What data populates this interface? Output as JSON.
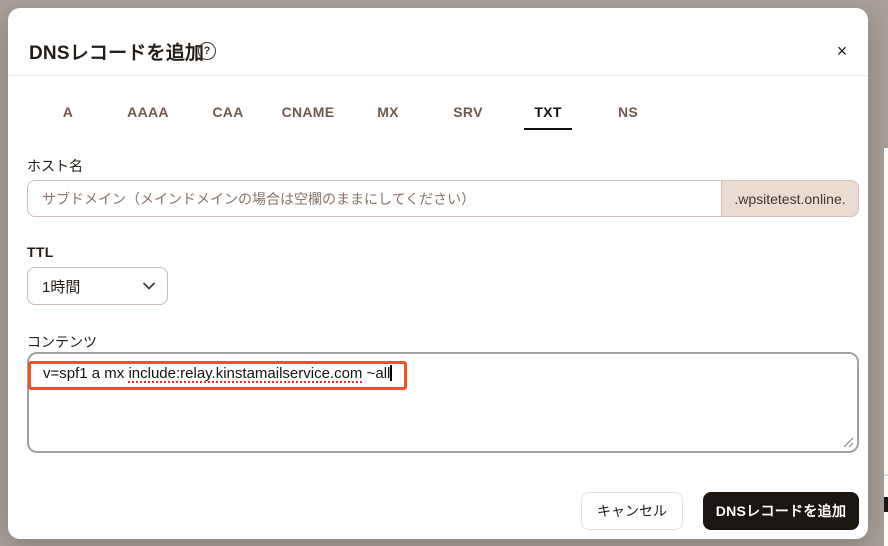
{
  "modal": {
    "title": "DNSレコードを追加",
    "help_symbol": "?",
    "close_symbol": "×"
  },
  "tabs": [
    {
      "label": "A"
    },
    {
      "label": "AAAA"
    },
    {
      "label": "CAA"
    },
    {
      "label": "CNAME"
    },
    {
      "label": "MX"
    },
    {
      "label": "SRV"
    },
    {
      "label": "TXT"
    },
    {
      "label": "NS"
    }
  ],
  "active_tab": "TXT",
  "form": {
    "hostname_label": "ホスト名",
    "hostname_placeholder": "サブドメイン（メインドメインの場合は空欄のままにしてください）",
    "hostname_value": "",
    "domain_suffix": ".wpsitetest.online.",
    "ttl_label": "TTL",
    "ttl_value": "1時間",
    "content_label": "コンテンツ",
    "content_value": "v=spf1 a mx include:relay.kinstamailservice.com ~all",
    "content_value_prefix": "v=spf1 a mx ",
    "content_value_marked": "include:relay.kinstamailservice.com",
    "content_value_suffix": " ~all"
  },
  "footer": {
    "cancel_label": "キャンセル",
    "submit_label": "DNSレコードを追加"
  },
  "colors": {
    "backdrop": "#a8a099",
    "annotation_box": "#f5501d",
    "primary_button": "#1c1612",
    "tab_inactive": "#6e5a50",
    "addon_background": "#ecdbd0"
  }
}
